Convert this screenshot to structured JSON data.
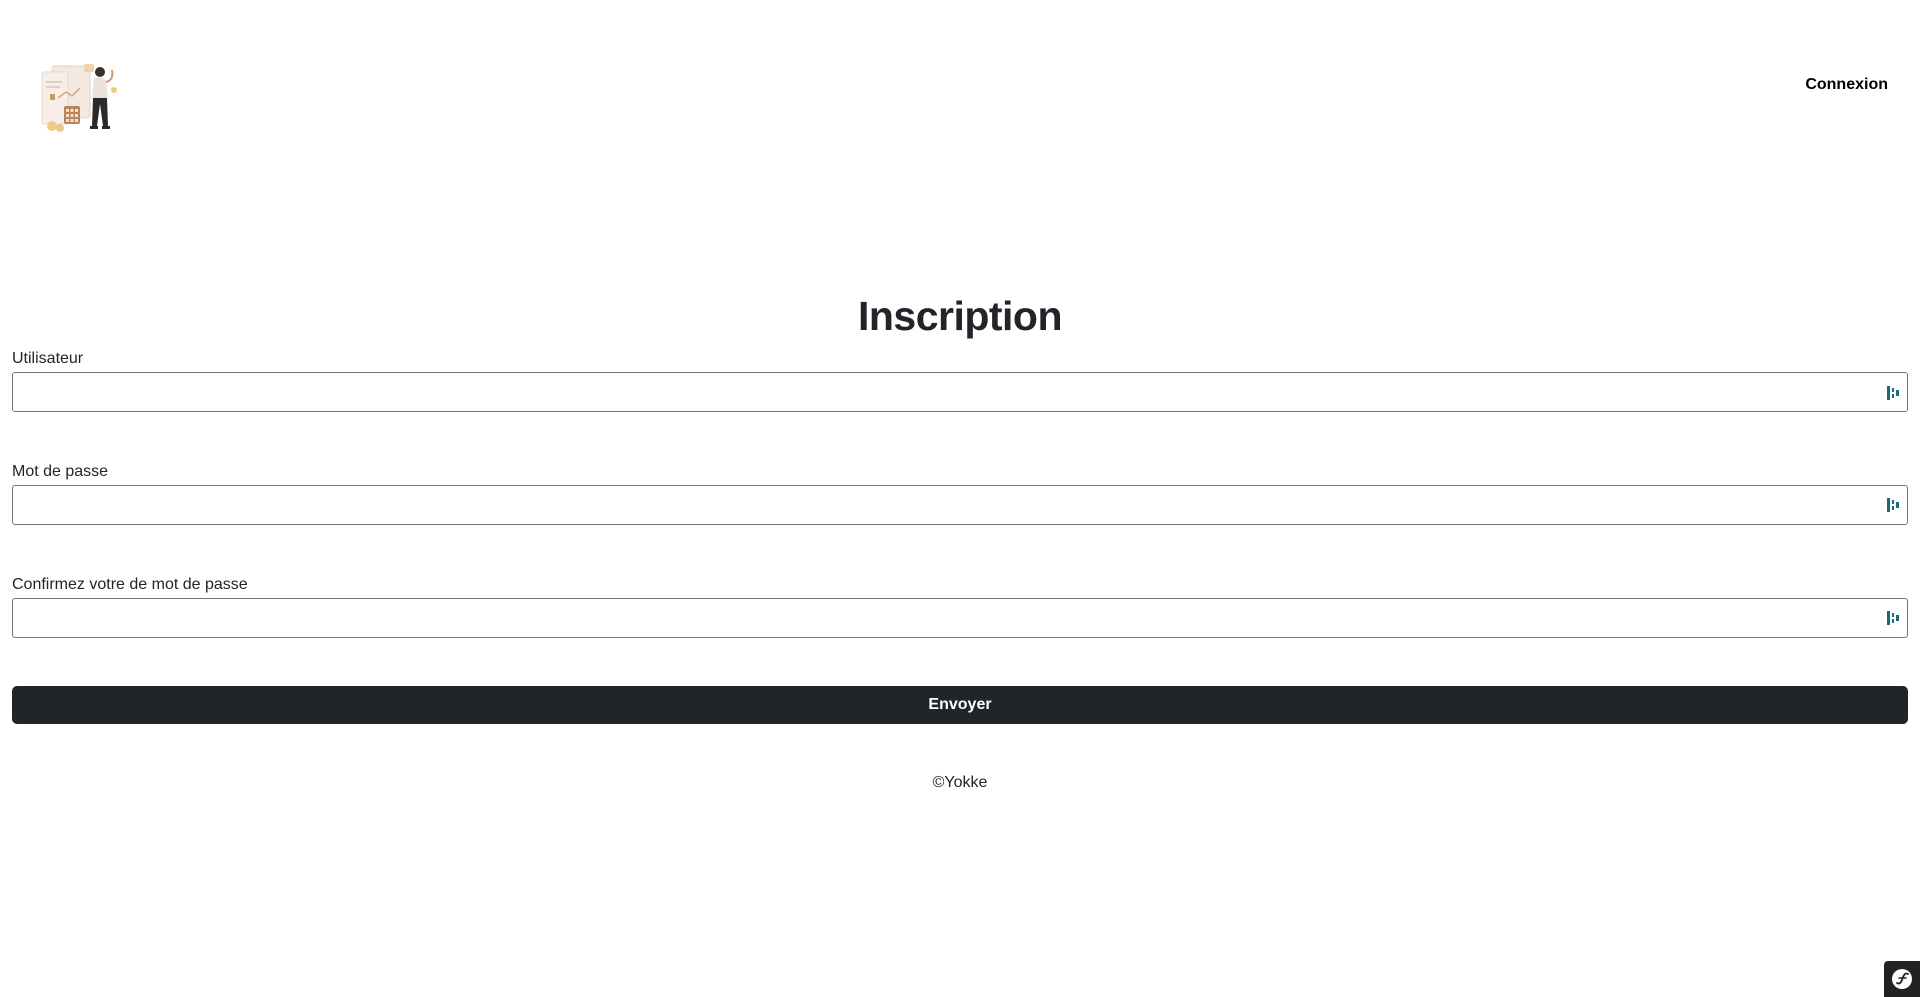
{
  "header": {
    "logo_alt": "logo",
    "nav_login_label": "Connexion"
  },
  "main": {
    "title": "Inscription",
    "fields": [
      {
        "label": "Utilisateur",
        "value": "",
        "type": "text"
      },
      {
        "label": "Mot de passe",
        "value": "",
        "type": "password"
      },
      {
        "label": "Confirmez votre de mot de passe",
        "value": "",
        "type": "password"
      }
    ],
    "submit_label": "Envoyer"
  },
  "footer": {
    "copyright": "©Yokke"
  },
  "icons": {
    "field_icon": "password-manager-key-icon",
    "toolbar_icon": "symfony-icon"
  },
  "colors": {
    "button_bg": "#212529",
    "text": "#212529",
    "input_icon": "#1a6b7a"
  }
}
